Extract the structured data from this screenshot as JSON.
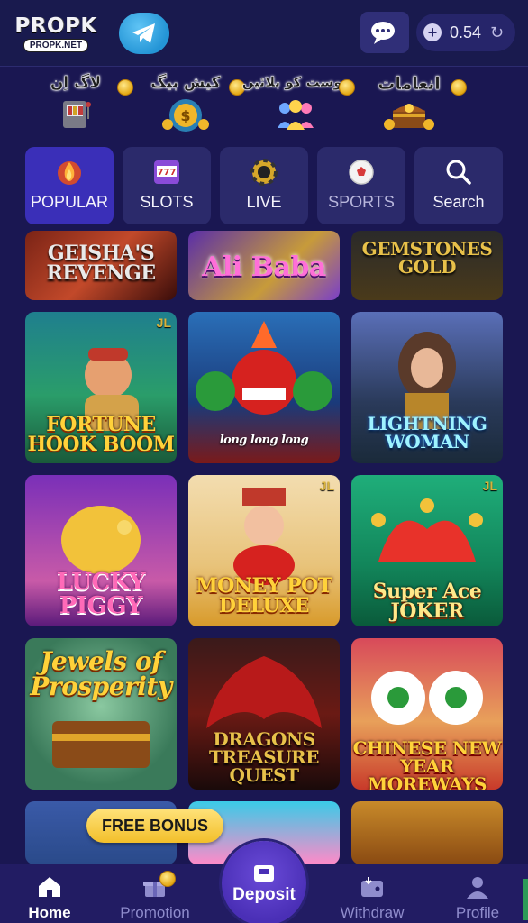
{
  "header": {
    "logo_main": "PROPK",
    "logo_sub": "PROPK.NET",
    "balance": "0.54"
  },
  "quick_links": [
    {
      "label": "لاگ اِن"
    },
    {
      "label": "کیش بیگ"
    },
    {
      "label": "دوست کو بلائیں"
    },
    {
      "label": "انعامات"
    }
  ],
  "categories": [
    {
      "label": "POPULAR",
      "active": true
    },
    {
      "label": "SLOTS"
    },
    {
      "label": "LIVE"
    },
    {
      "label": "SPORTS"
    },
    {
      "label": "Search"
    }
  ],
  "games": [
    {
      "title": "GEISHA'S REVENGE"
    },
    {
      "title": "Ali Baba"
    },
    {
      "title": "GEMSTONES GOLD"
    },
    {
      "title": "FORTUNE HOOK BOOM",
      "badge": "JL"
    },
    {
      "title": "long long long"
    },
    {
      "title": "LIGHTNING WOMAN"
    },
    {
      "title": "LUCKY PIGGY"
    },
    {
      "title": "MONEY POT DELUXE",
      "badge": "JL"
    },
    {
      "title": "Super Ace JOKER",
      "badge": "JL"
    },
    {
      "title": "Jewels of Prosperity"
    },
    {
      "title": "DRAGONS TREASURE QUEST"
    },
    {
      "title": "CHINESE NEW YEAR MOREWAYS"
    }
  ],
  "free_bonus": "FREE BONUS",
  "bottom_nav": [
    {
      "label": "Home",
      "active": true
    },
    {
      "label": "Promotion"
    },
    {
      "label": "Deposit"
    },
    {
      "label": "Withdraw"
    },
    {
      "label": "Profile"
    }
  ],
  "colors": {
    "background": "#1a1752",
    "active_tab": "#3a2fb8",
    "tab": "#2b2a6b",
    "nav": "#221c63",
    "gold": "#f2bf2a"
  }
}
